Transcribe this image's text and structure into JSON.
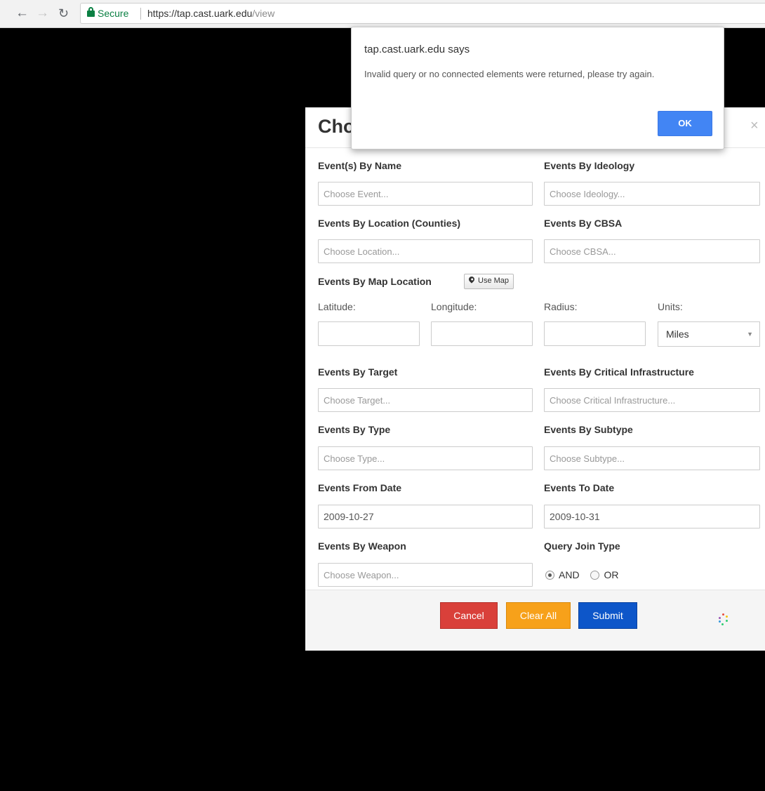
{
  "browser": {
    "security_label": "Secure",
    "url_base": "https://tap.cast.uark.edu",
    "url_path": "/view"
  },
  "alert": {
    "title": "tap.cast.uark.edu says",
    "message": "Invalid query or no connected elements were returned, please try again.",
    "ok_label": "OK"
  },
  "modal": {
    "title": "Choose",
    "close_glyph": "×",
    "fields": {
      "event_name": {
        "label": "Event(s) By Name",
        "placeholder": "Choose Event..."
      },
      "ideology": {
        "label": "Events By Ideology",
        "placeholder": "Choose Ideology..."
      },
      "location": {
        "label": "Events By Location (Counties)",
        "placeholder": "Choose Location..."
      },
      "cbsa": {
        "label": "Events By CBSA",
        "placeholder": "Choose CBSA..."
      },
      "map_location": {
        "label": "Events By Map Location",
        "use_map_label": "Use Map",
        "latitude_label": "Latitude:",
        "longitude_label": "Longitude:",
        "radius_label": "Radius:",
        "units_label": "Units:",
        "units_value": "Miles"
      },
      "target": {
        "label": "Events By Target",
        "placeholder": "Choose Target..."
      },
      "critical_infrastructure": {
        "label": "Events By Critical Infrastructure",
        "placeholder": "Choose Critical Infrastructure..."
      },
      "type": {
        "label": "Events By Type",
        "placeholder": "Choose Type..."
      },
      "subtype": {
        "label": "Events By Subtype",
        "placeholder": "Choose Subtype..."
      },
      "from_date": {
        "label": "Events From Date",
        "value": "2009-10-27"
      },
      "to_date": {
        "label": "Events To Date",
        "value": "2009-10-31"
      },
      "weapon": {
        "label": "Events By Weapon",
        "placeholder": "Choose Weapon..."
      },
      "join_type": {
        "label": "Query Join Type",
        "options": [
          "AND",
          "OR"
        ],
        "selected": "AND"
      }
    },
    "footer": {
      "cancel_label": "Cancel",
      "clear_label": "Clear All",
      "submit_label": "Submit"
    }
  },
  "colors": {
    "cancel": "#d9403a",
    "clear_all": "#f7a11a",
    "submit": "#0d56c9",
    "ok": "#4285f4",
    "secure": "#0b8043",
    "overlay": "#000000"
  }
}
